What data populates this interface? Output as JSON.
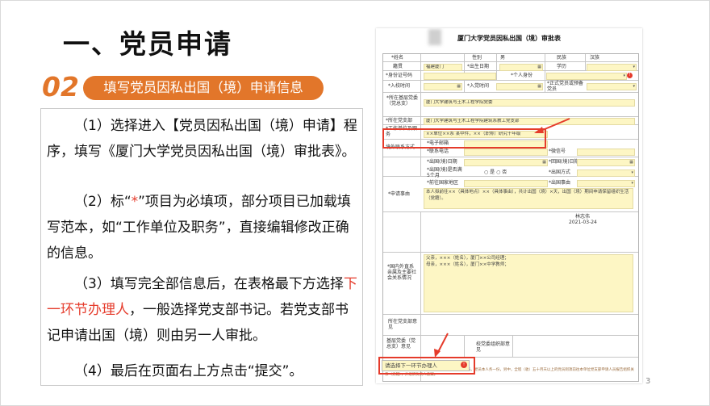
{
  "slide": {
    "title": "一、党员申请",
    "section_number": "02",
    "section_title": "填写党员因私出国（境）申请信息",
    "page_number": "3"
  },
  "instructions": {
    "p1": "（1）选择进入【党员因私出国（境）申请】程序，填写《厦门大学党员因私出国（境）审批表》。",
    "p2_a": "（2）标“",
    "p2_star": "*",
    "p2_b": "”项目为必填项，部分项目已加载填写范本，如“工作单位及职务”，直接编辑修改正确的信息。",
    "p3_a": "（3）填写完全部信息后，在表格最下方选择",
    "p3_red": "下一环节办理人",
    "p3_b": "，一般选择党支部书记。若党支部书记申请出国（境）则由另一人审批。",
    "p4": "（4）最后在页面右上方点击“提交”。"
  },
  "form": {
    "title": "厦门大学党员因私出国（境）审批表",
    "labels": {
      "name": "*姓名",
      "gender": "性别",
      "ethnicity": "民族",
      "native": "籍贯",
      "birth": "*出生日期",
      "education": "学历",
      "id_number": "*身份证号码",
      "identity": "*个人身份",
      "school_join": "*入校时间",
      "party_join": "*入党时间",
      "formal_member": "*正式党员或预备党员",
      "grassroots_committee": "*所在基层党委（党总支）",
      "branch": "*所在党支部",
      "work_unit": "*工作单位及职务",
      "abroad_contact": "境外联系方式",
      "email": "*电子邮箱",
      "contact_phone": "*联系电话",
      "wechat": "*微信号",
      "depart_date": "*出国(境)日期",
      "return_date": "*回国(境)日期",
      "over_5_months": "*出国(境)是否满5个月",
      "yes": "是",
      "no": "否",
      "country": "*出国方式",
      "destination": "*前往国家地区",
      "cause": "*出国事由",
      "application_reason": "*申请事由",
      "relatives": "*国内外直系亲属及主要社会关系情况",
      "branch_opinion": "所在党支部意见",
      "grassroots_opinion": "基层党委（党总支）意见",
      "school_opinion": "校党委组织部意见"
    },
    "values": {
      "gender": "男",
      "ethnicity": "汉族",
      "native": "福建厦门",
      "identity_placeholder": "",
      "grassroots_committee": "厦门大学建筑与土木工程学院党委",
      "branch": "厦门大学建筑与土木工程学院建筑系教工党支部",
      "work_unit": "××单位××系  某中件，××（职称）研究十年级",
      "reason_text": "本人拟前往××（具体地点）××（具体事由），共计出国（境）×天，出国（境）期间申请保留组织生活（党籍）。",
      "signer": "林志伟",
      "sign_date": "2021-03-24",
      "relatives_text": "父亲，×××（姓名），厦门××公司经理；\n母亲，×××（姓名），厦门××中学教师；"
    },
    "next_handler_placeholder": "请选择下一环节办理人",
    "footer_note": "注：出国（境）时间超过3个月（含）的，需填写此表。党员本人务一份，另中，全程（收）五十月天以上的党员则须前往本单位党支部申请人员报告组织关系（党籍），并组织负责人备案。"
  }
}
